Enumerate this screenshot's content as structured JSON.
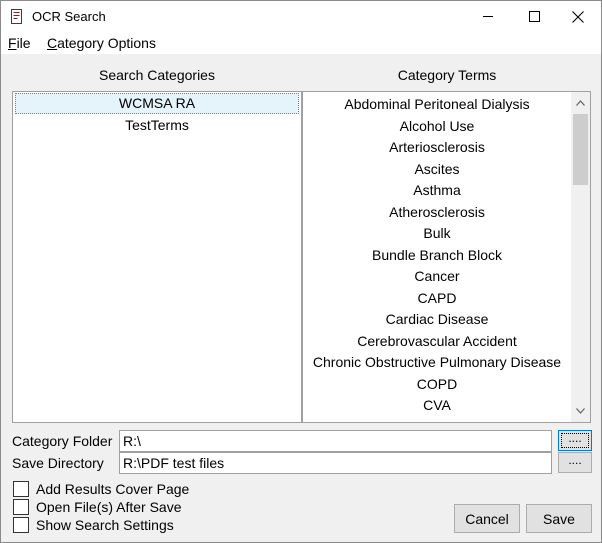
{
  "window": {
    "title": "OCR Search"
  },
  "menu": {
    "file_mnemonic": "F",
    "file_rest": "ile",
    "cat_mnemonic": "C",
    "cat_rest": "ategory Options"
  },
  "categories": {
    "heading": "Search Categories",
    "items": [
      "WCMSA RA",
      "TestTerms"
    ],
    "selected": "WCMSA RA"
  },
  "terms": {
    "heading": "Category Terms",
    "items": [
      "Abdominal Peritoneal Dialysis",
      "Alcohol Use",
      "Arteriosclerosis",
      "Ascites",
      "Asthma",
      "Atherosclerosis",
      "Bulk",
      "Bundle Branch Block",
      "Cancer",
      "CAPD",
      "Cardiac Disease",
      "Cerebrovascular Accident",
      "Chronic Obstructive Pulmonary Disease",
      "COPD",
      "CVA"
    ]
  },
  "fields": {
    "category_folder_label": "Category Folder",
    "category_folder_value": "R:\\",
    "save_directory_label": "Save Directory",
    "save_directory_value": "R:\\PDF test files",
    "browse_label": "...."
  },
  "options": {
    "add_cover": "Add Results Cover Page",
    "open_after": "Open File(s) After Save",
    "show_settings": "Show Search Settings"
  },
  "buttons": {
    "cancel": "Cancel",
    "save": "Save"
  },
  "colors": {
    "selection_bg": "#e5f3fb",
    "focus_border": "#0078d7"
  }
}
